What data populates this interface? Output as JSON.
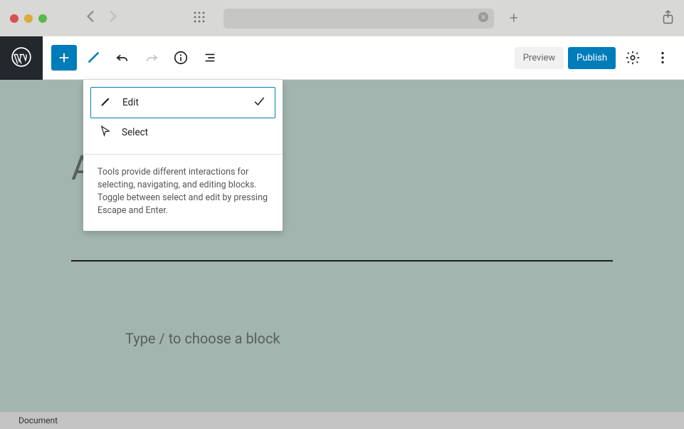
{
  "toolbar": {
    "preview_label": "Preview",
    "publish_label": "Publish"
  },
  "tool_menu": {
    "edit_label": "Edit",
    "select_label": "Select",
    "description": "Tools provide different interactions for selecting, navigating, and editing blocks. Toggle between select and edit by pressing Escape and Enter."
  },
  "editor": {
    "title_placeholder_partial": "A            e",
    "block_prompt": "Type / to choose a block"
  },
  "footer": {
    "breadcrumb": "Document"
  }
}
